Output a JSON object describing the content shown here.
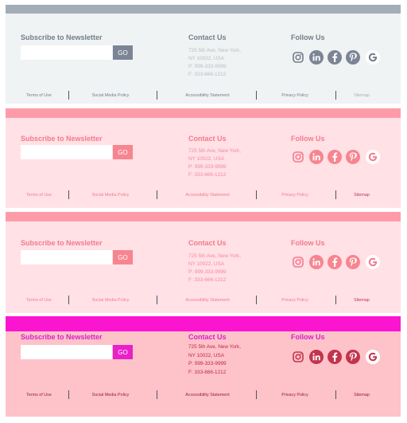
{
  "footers": [
    {
      "theme": {
        "bar": "#a2adb8",
        "bg": "#eff3f3",
        "title": "#747d8a",
        "contact_text": "#b9bec4",
        "button": "#7b8595",
        "button_text": "#ffffff",
        "icon_circle": "#7b8595",
        "icon_fg": "#ffffff",
        "instagram": "#747d8a",
        "google": "#747d8a",
        "google_bg": "#ffffff",
        "links": "#747d8a",
        "sitemap": "#a9b0b7",
        "sep": "#4d5560"
      },
      "newsletter": {
        "title": "Subscribe to Newsletter",
        "placeholder": "",
        "button": "GO"
      },
      "contact": {
        "title": "Contact Us",
        "address1": "725 5th Ave, New York,",
        "address2": "NY 10022, USA",
        "phone": "P: 999-333-9999",
        "fax": "F: 333-666-1212"
      },
      "follow": {
        "title": "Follow Us",
        "icons": [
          "instagram-icon",
          "linkedin-icon",
          "facebook-icon",
          "pinterest-icon",
          "google-icon"
        ]
      },
      "links": {
        "terms": "Terms of Use",
        "social": "Social Media Policy",
        "accessibility": "Accessibility Statement",
        "privacy": "Privacy Policy",
        "sitemap": "Sitemap"
      }
    },
    {
      "theme": {
        "bar": "#fd9ca8",
        "bg": "#ffe1e6",
        "title": "#f47a8c",
        "contact_text": "#f5899a",
        "button": "#f7858f",
        "button_text": "#ffffff",
        "icon_circle": "#f7858f",
        "icon_fg": "#ffffff",
        "instagram": "#f47a8c",
        "google": "#f47a8c",
        "google_bg": "#ffffff",
        "links": "#f47a8c",
        "sitemap": "#c2344d",
        "sep": "#4d5560"
      },
      "newsletter": {
        "title": "Subscribe to Newsletter",
        "placeholder": "",
        "button": "GO"
      },
      "contact": {
        "title": "Contact Us",
        "address1": "725 5th Ave, New York,",
        "address2": "NY 10022, USA",
        "phone": "P: 999-333-9999",
        "fax": "F: 333-666-1212"
      },
      "follow": {
        "title": "Follow Us",
        "icons": [
          "instagram-icon",
          "linkedin-icon",
          "facebook-icon",
          "pinterest-icon",
          "google-icon"
        ]
      },
      "links": {
        "terms": "Terms of Use",
        "social": "Social Media Policy",
        "accessibility": "Accessibility Statement",
        "privacy": "Privacy Policy",
        "sitemap": "Sitemap"
      }
    },
    {
      "theme": {
        "bar": "#fd9ca8",
        "bg": "#ffe1e6",
        "title": "#f47a8c",
        "contact_text": "#f5899a",
        "button": "#f7858f",
        "button_text": "#ffffff",
        "icon_circle": "#f7858f",
        "icon_fg": "#ffffff",
        "instagram": "#f47a8c",
        "google": "#f47a8c",
        "google_bg": "#ffffff",
        "links": "#f47a8c",
        "sitemap": "#c2344d",
        "sep": "#4d5560"
      },
      "newsletter": {
        "title": "Subscribe to Newsletter",
        "placeholder": "",
        "button": "GO"
      },
      "contact": {
        "title": "Contact Us",
        "address1": "725 5th Ave, New York,",
        "address2": "NY 10022, USA",
        "phone": "P: 999-333-9999",
        "fax": "F: 333-666-1212"
      },
      "follow": {
        "title": "Follow Us",
        "icons": [
          "instagram-icon",
          "linkedin-icon",
          "facebook-icon",
          "pinterest-icon",
          "google-icon"
        ]
      },
      "links": {
        "terms": "Terms of Use",
        "social": "Social Media Policy",
        "accessibility": "Accessibility Statement",
        "privacy": "Privacy Policy",
        "sitemap": "Sitemap"
      }
    },
    {
      "theme": {
        "bar": "#fb15d0",
        "bg": "#fec3c9",
        "title": "#d621c8",
        "contact_text": "#b8284c",
        "button": "#ea20c8",
        "button_text": "#ffffff",
        "icon_circle": "#c2344d",
        "icon_fg": "#ffffff",
        "instagram": "#c2344d",
        "google": "#c2344d",
        "google_bg": "#ffffff",
        "links": "#8c2338",
        "sitemap": "#8c2338",
        "sep": "#4d5560"
      },
      "newsletter": {
        "title": "Subscribe to Newsletter",
        "placeholder": "",
        "button": "GO"
      },
      "contact": {
        "title": "Contact Us",
        "address1": "725 5th Ave, New York,",
        "address2": "NY 10022, USA",
        "phone": "P: 999-333-9999",
        "fax": "F: 333-666-1212"
      },
      "follow": {
        "title": "Follow Us",
        "icons": [
          "instagram-icon",
          "linkedin-icon",
          "facebook-icon",
          "pinterest-icon",
          "google-icon"
        ]
      },
      "links": {
        "terms": "Terms of Use",
        "social": "Social Media Policy",
        "accessibility": "Accessibility Statement",
        "privacy": "Privacy Policy",
        "sitemap": "Sitemap"
      }
    }
  ]
}
